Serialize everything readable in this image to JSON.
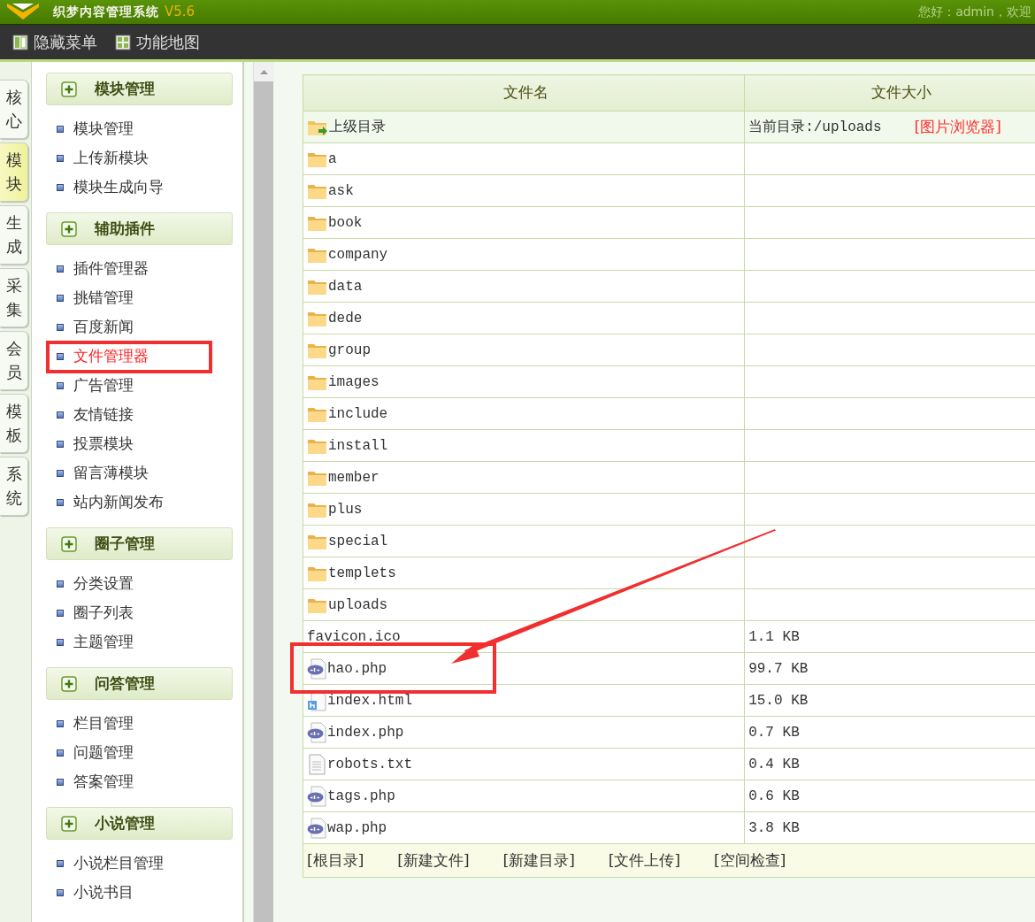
{
  "header": {
    "title": "织梦内容管理系统",
    "version": "V5.6",
    "greeting": "您好：admin，欢迎"
  },
  "toolbar": [
    {
      "label": "隐藏菜单",
      "kind": "hide"
    },
    {
      "label": "功能地图",
      "kind": "map"
    }
  ],
  "side_tabs": [
    {
      "label": "核心",
      "selected": false
    },
    {
      "label": "模块",
      "selected": true
    },
    {
      "label": "生成",
      "selected": false
    },
    {
      "label": "采集",
      "selected": false
    },
    {
      "label": "会员",
      "selected": false
    },
    {
      "label": "模板",
      "selected": false
    },
    {
      "label": "系统",
      "selected": false
    }
  ],
  "menu": [
    {
      "title": "模块管理",
      "items": [
        {
          "label": "模块管理",
          "selected": false,
          "highlighted": false
        },
        {
          "label": "上传新模块",
          "selected": false,
          "highlighted": false
        },
        {
          "label": "模块生成向导",
          "selected": false,
          "highlighted": false
        }
      ]
    },
    {
      "title": "辅助插件",
      "items": [
        {
          "label": "插件管理器",
          "selected": false,
          "highlighted": false
        },
        {
          "label": "挑错管理",
          "selected": false,
          "highlighted": false
        },
        {
          "label": "百度新闻",
          "selected": false,
          "highlighted": false
        },
        {
          "label": "文件管理器",
          "selected": true,
          "highlighted": true
        },
        {
          "label": "广告管理",
          "selected": false,
          "highlighted": false
        },
        {
          "label": "友情链接",
          "selected": false,
          "highlighted": false
        },
        {
          "label": "投票模块",
          "selected": false,
          "highlighted": false
        },
        {
          "label": "留言薄模块",
          "selected": false,
          "highlighted": false
        },
        {
          "label": "站内新闻发布",
          "selected": false,
          "highlighted": false
        }
      ]
    },
    {
      "title": "圈子管理",
      "items": [
        {
          "label": "分类设置",
          "selected": false,
          "highlighted": false
        },
        {
          "label": "圈子列表",
          "selected": false,
          "highlighted": false
        },
        {
          "label": "主题管理",
          "selected": false,
          "highlighted": false
        }
      ]
    },
    {
      "title": "问答管理",
      "items": [
        {
          "label": "栏目管理",
          "selected": false,
          "highlighted": false
        },
        {
          "label": "问题管理",
          "selected": false,
          "highlighted": false
        },
        {
          "label": "答案管理",
          "selected": false,
          "highlighted": false
        }
      ]
    },
    {
      "title": "小说管理",
      "items": [
        {
          "label": "小说栏目管理",
          "selected": false,
          "highlighted": false
        },
        {
          "label": "小说书目",
          "selected": false,
          "highlighted": false
        }
      ]
    }
  ],
  "file_table": {
    "columns": [
      "文件名",
      "文件大小"
    ],
    "parent_row": {
      "label": "上级目录",
      "current_dir": "当前目录:/uploads",
      "link": "[图片浏览器]"
    },
    "rows": [
      {
        "kind": "folder",
        "name": "a",
        "highlighted": false
      },
      {
        "kind": "folder",
        "name": "ask",
        "highlighted": false
      },
      {
        "kind": "folder",
        "name": "book",
        "highlighted": false
      },
      {
        "kind": "folder",
        "name": "company",
        "highlighted": false
      },
      {
        "kind": "folder",
        "name": "data",
        "highlighted": false
      },
      {
        "kind": "folder",
        "name": "dede",
        "highlighted": false
      },
      {
        "kind": "folder",
        "name": "group",
        "highlighted": false
      },
      {
        "kind": "folder",
        "name": "images",
        "highlighted": false
      },
      {
        "kind": "folder",
        "name": "include",
        "highlighted": false
      },
      {
        "kind": "folder",
        "name": "install",
        "highlighted": false
      },
      {
        "kind": "folder",
        "name": "member",
        "highlighted": false
      },
      {
        "kind": "folder",
        "name": "plus",
        "highlighted": false
      },
      {
        "kind": "folder",
        "name": "special",
        "highlighted": false
      },
      {
        "kind": "folder",
        "name": "templets",
        "highlighted": false
      },
      {
        "kind": "folder",
        "name": "uploads",
        "highlighted": false
      },
      {
        "kind": "plain",
        "name": "favicon.ico",
        "size": "1.1 KB",
        "highlighted": false
      },
      {
        "kind": "php",
        "name": "hao.php",
        "size": "99.7 KB",
        "highlighted": true
      },
      {
        "kind": "html",
        "name": "index.html",
        "size": "15.0 KB",
        "highlighted": false
      },
      {
        "kind": "php",
        "name": "index.php",
        "size": "0.7 KB",
        "highlighted": false
      },
      {
        "kind": "txt",
        "name": "robots.txt",
        "size": "0.4 KB",
        "highlighted": false
      },
      {
        "kind": "php",
        "name": "tags.php",
        "size": "0.6 KB",
        "highlighted": false
      },
      {
        "kind": "php",
        "name": "wap.php",
        "size": "3.8 KB",
        "highlighted": false
      }
    ],
    "footer_links": [
      "[根目录]",
      "[新建文件]",
      "[新建目录]",
      "[文件上传]",
      "[空间检查]"
    ]
  }
}
